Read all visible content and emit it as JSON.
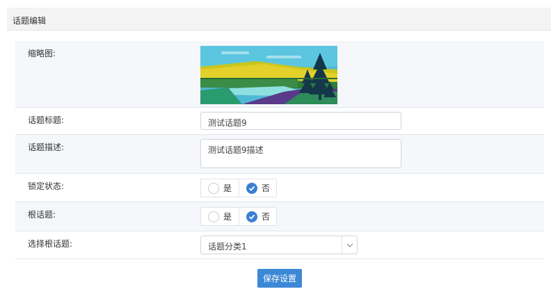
{
  "header": {
    "title": "话题编辑"
  },
  "form": {
    "thumbnail": {
      "label": "缩略图:",
      "image": "landscape-thumbnail"
    },
    "title": {
      "label": "话题标题:",
      "value": "测试话题9"
    },
    "description": {
      "label": "话题描述:",
      "value": "测试话题9描述"
    },
    "lock_status": {
      "label": "锁定状态:",
      "options": [
        "是",
        "否"
      ],
      "selected": "否"
    },
    "root_topic": {
      "label": "根话题:",
      "options": [
        "是",
        "否"
      ],
      "selected": "否"
    },
    "select_root": {
      "label": "选择根话题:",
      "value": "话题分类1"
    }
  },
  "actions": {
    "save_label": "保存设置"
  },
  "colors": {
    "accent": "#3a7fd5",
    "header_bg": "#f3f3f3",
    "row_alt_bg": "#f5f7fa"
  },
  "icons": {
    "check": "check-icon",
    "dropdown": "chevron-down-icon"
  }
}
